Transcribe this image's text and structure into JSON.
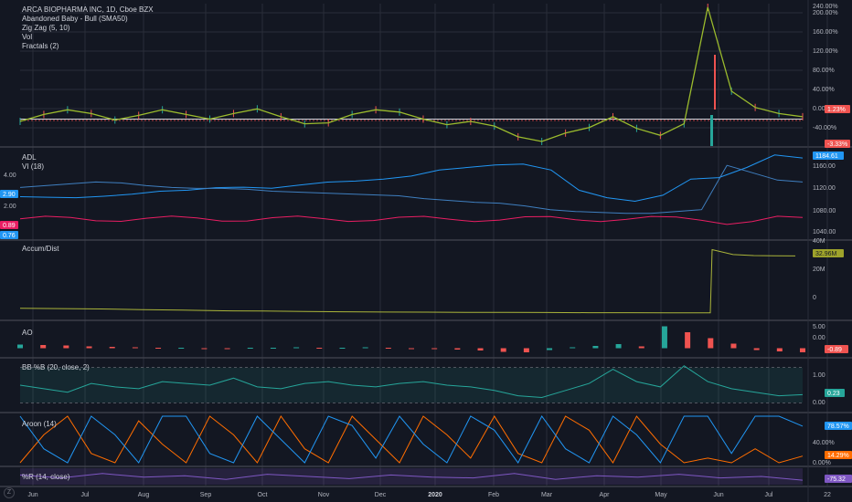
{
  "header": {
    "symbol": "ARCA BIOPHARMA INC, 1D, Cboe BZX",
    "indicators": [
      "Abandoned Baby - Bull (SMA50)",
      "Zig Zag (5, 10)",
      "Vol",
      "Fractals (2)"
    ]
  },
  "panes": {
    "adl": {
      "label": "ADL",
      "label2": "VI (18)"
    },
    "accdist": {
      "label": "Accum/Dist"
    },
    "ao": {
      "label": "AO"
    },
    "bb": {
      "label": "BB %B (20, close, 2)"
    },
    "aroon": {
      "label": "Aroon (14)"
    },
    "wr": {
      "label": "%R (14, close)"
    }
  },
  "badges": {
    "price_1": "1.23%",
    "price_2": "-3.33%",
    "adl_value": "1184.61",
    "vi_plus": "2.90",
    "vi_minus": "0.89",
    "vi_low": "0.76",
    "accdist_value": "32.96M",
    "ao_value": "-0.89",
    "bb_value": "0.23",
    "aroon_up": "78.57%",
    "aroon_down": "14.29%",
    "wr_value": "-75.32"
  },
  "colors": {
    "background": "#131722",
    "grid": "#2a2e39",
    "zigzag": "#9bbb2d",
    "adl": "#2196f3",
    "vi_plus": "#2196f3",
    "vi_minus": "#e91e63",
    "accdist": "#aab43a",
    "ao_up": "#26a69a",
    "ao_down": "#ef5350",
    "bb": "#26a69a",
    "aroon_up": "#2196f3",
    "aroon_down": "#ff6d00",
    "wr": "#7e57c2",
    "badge_red": "#ef5350",
    "badge_blue": "#2196f3",
    "badge_olive": "#9ea32b",
    "badge_teal": "#26a69a",
    "badge_orange": "#ff6d00",
    "badge_purple": "#7e57c2",
    "badge_pink": "#e91e63"
  },
  "chart_data": [
    {
      "type": "line",
      "title": "ARCA BIOPHARMA INC, 1D, Cboe BZX",
      "xlabel": "",
      "ylabel": "",
      "x": [
        "Jun",
        "Jul",
        "Aug",
        "Sep",
        "Oct",
        "Nov",
        "Dec",
        "2020",
        "Feb",
        "Mar",
        "Apr",
        "May",
        "Jun",
        "Jul",
        "22"
      ],
      "y_scale": "percentage",
      "ylim": [
        -40,
        240
      ],
      "y_ticks": [
        "-40.00%",
        "0.00%",
        "40.00%",
        "80.00%",
        "120.00%",
        "160.00%",
        "200.00%",
        "240.00%"
      ],
      "series": [
        {
          "values": [
            -5,
            10,
            20,
            12,
            -2,
            8,
            20,
            10,
            0,
            12,
            22,
            5,
            -10,
            -8,
            10,
            20,
            15,
            0,
            -12,
            -5,
            -15,
            -38,
            -48,
            -30,
            -18,
            5,
            -20,
            -35,
            -10,
            240,
            60,
            25,
            12,
            5
          ]
        }
      ]
    },
    {
      "type": "line",
      "title": "ADL",
      "y_ticks": [
        "1040.00",
        "1080.00",
        "1120.00",
        "1160.00"
      ],
      "left_ticks": [
        "4.00",
        "2.00"
      ],
      "series": [
        {
          "name": "ADL",
          "values": [
            1107,
            1106,
            1105,
            1108,
            1112,
            1118,
            1120,
            1125,
            1126,
            1124,
            1130,
            1136,
            1138,
            1142,
            1148,
            1160,
            1165,
            1170,
            1172,
            1160,
            1120,
            1105,
            1098,
            1110,
            1142,
            1145,
            1165,
            1190,
            1184
          ]
        },
        {
          "name": "VI (18)",
          "values": [
            2.6,
            2.7,
            2.8,
            2.9,
            2.85,
            2.7,
            2.6,
            2.55,
            2.55,
            2.5,
            2.4,
            2.35,
            2.3,
            2.25,
            2.2,
            2.15,
            2.0,
            1.9,
            1.8,
            1.75,
            1.6,
            1.4,
            1.3,
            1.25,
            1.2,
            1.2,
            1.3,
            1.4,
            3.8,
            3.4,
            3.0,
            2.9
          ]
        }
      ]
    },
    {
      "type": "line",
      "title": "Accum/Dist",
      "y_ticks": [
        "0",
        "20M",
        "40M"
      ],
      "series": [
        {
          "name": "Accum/Dist",
          "values": [
            -9,
            -9.2,
            -9.5,
            -10,
            -10.5,
            -11,
            -11.2,
            -11.5,
            -11.8,
            -12,
            -12.1,
            -12.2,
            -12.3,
            -12.4,
            -12.5,
            -12.5,
            -12.6,
            -12.6,
            -12.6,
            38,
            34,
            33.2,
            33,
            32.96
          ]
        }
      ]
    },
    {
      "type": "bar",
      "title": "AO",
      "y_ticks": [
        "0.00",
        "5.00"
      ],
      "series": [
        {
          "name": "AO",
          "values": [
            0.8,
            0.7,
            0.6,
            0.4,
            0.3,
            0.2,
            0.1,
            0.1,
            0,
            -0.1,
            0.1,
            0.1,
            0.2,
            0.1,
            0.1,
            0.2,
            0.1,
            0,
            -0.2,
            -0.3,
            -0.5,
            -0.8,
            -0.9,
            -0.4,
            0.2,
            0.5,
            0.9,
            0.4,
            4.8,
            3.5,
            2.2,
            1.0,
            -0.4,
            -0.7,
            -0.89
          ]
        }
      ]
    },
    {
      "type": "area",
      "title": "BB %B (20, close, 2)",
      "y_ticks": [
        "0.00",
        "1.00"
      ],
      "series": [
        {
          "name": "BB %B",
          "values": [
            0.5,
            0.4,
            0.3,
            0.55,
            0.45,
            0.4,
            0.6,
            0.55,
            0.5,
            0.7,
            0.45,
            0.4,
            0.55,
            0.6,
            0.5,
            0.45,
            0.55,
            0.6,
            0.5,
            0.45,
            0.35,
            0.2,
            0.15,
            0.35,
            0.55,
            0.95,
            0.6,
            0.45,
            1.05,
            0.6,
            0.4,
            0.3,
            0.2,
            0.23
          ]
        }
      ]
    },
    {
      "type": "line",
      "title": "Aroon (14)",
      "y_ticks": [
        "0.00%",
        "40.00%"
      ],
      "series": [
        {
          "name": "Aroon Up",
          "values": [
            100,
            30,
            0,
            100,
            60,
            0,
            100,
            100,
            20,
            0,
            100,
            50,
            0,
            100,
            80,
            10,
            100,
            40,
            0,
            100,
            70,
            0,
            100,
            30,
            0,
            100,
            60,
            0,
            100,
            100,
            20,
            100,
            100,
            78.57
          ]
        },
        {
          "name": "Aroon Down",
          "values": [
            0,
            60,
            100,
            20,
            0,
            90,
            40,
            0,
            100,
            60,
            0,
            100,
            30,
            0,
            100,
            50,
            0,
            100,
            60,
            10,
            100,
            20,
            0,
            100,
            70,
            0,
            100,
            40,
            0,
            10,
            0,
            30,
            0,
            14.29
          ]
        }
      ]
    },
    {
      "type": "line",
      "title": "%R (14, close)",
      "series": [
        {
          "name": "%R",
          "values": [
            -40,
            -60,
            -30,
            -55,
            -45,
            -70,
            -35,
            -50,
            -65,
            -40,
            -55,
            -60,
            -30,
            -70,
            -45,
            -55,
            -35,
            -60,
            -50,
            -75.32
          ]
        }
      ]
    }
  ]
}
